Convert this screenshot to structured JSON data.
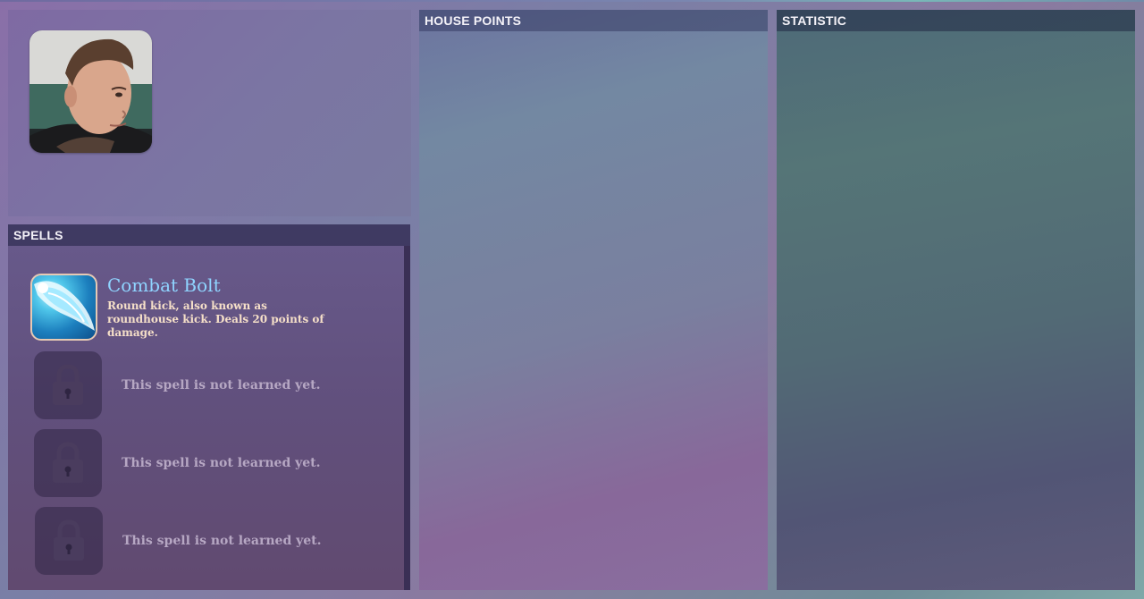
{
  "panels": {
    "spells_title": "SPELLS",
    "house_points_title": "HOUSE POINTS",
    "statistic_title": "STATISTIC"
  },
  "spells": [
    {
      "name": "Combat Bolt",
      "description": "Round kick, also known as roundhouse kick. Deals 20 points of damage.",
      "learned": true,
      "icon": "combat-bolt-icon"
    },
    {
      "locked_text": "This spell is not learned yet.",
      "learned": false,
      "icon": "lock-icon"
    },
    {
      "locked_text": "This spell is not learned yet.",
      "learned": false,
      "icon": "lock-icon"
    },
    {
      "locked_text": "This spell is not learned yet.",
      "learned": false,
      "icon": "lock-icon"
    }
  ],
  "colors": {
    "spell_name": "#8fd4ff",
    "spell_desc": "#f5dfc8",
    "locked_text": "#b6a7c3"
  }
}
